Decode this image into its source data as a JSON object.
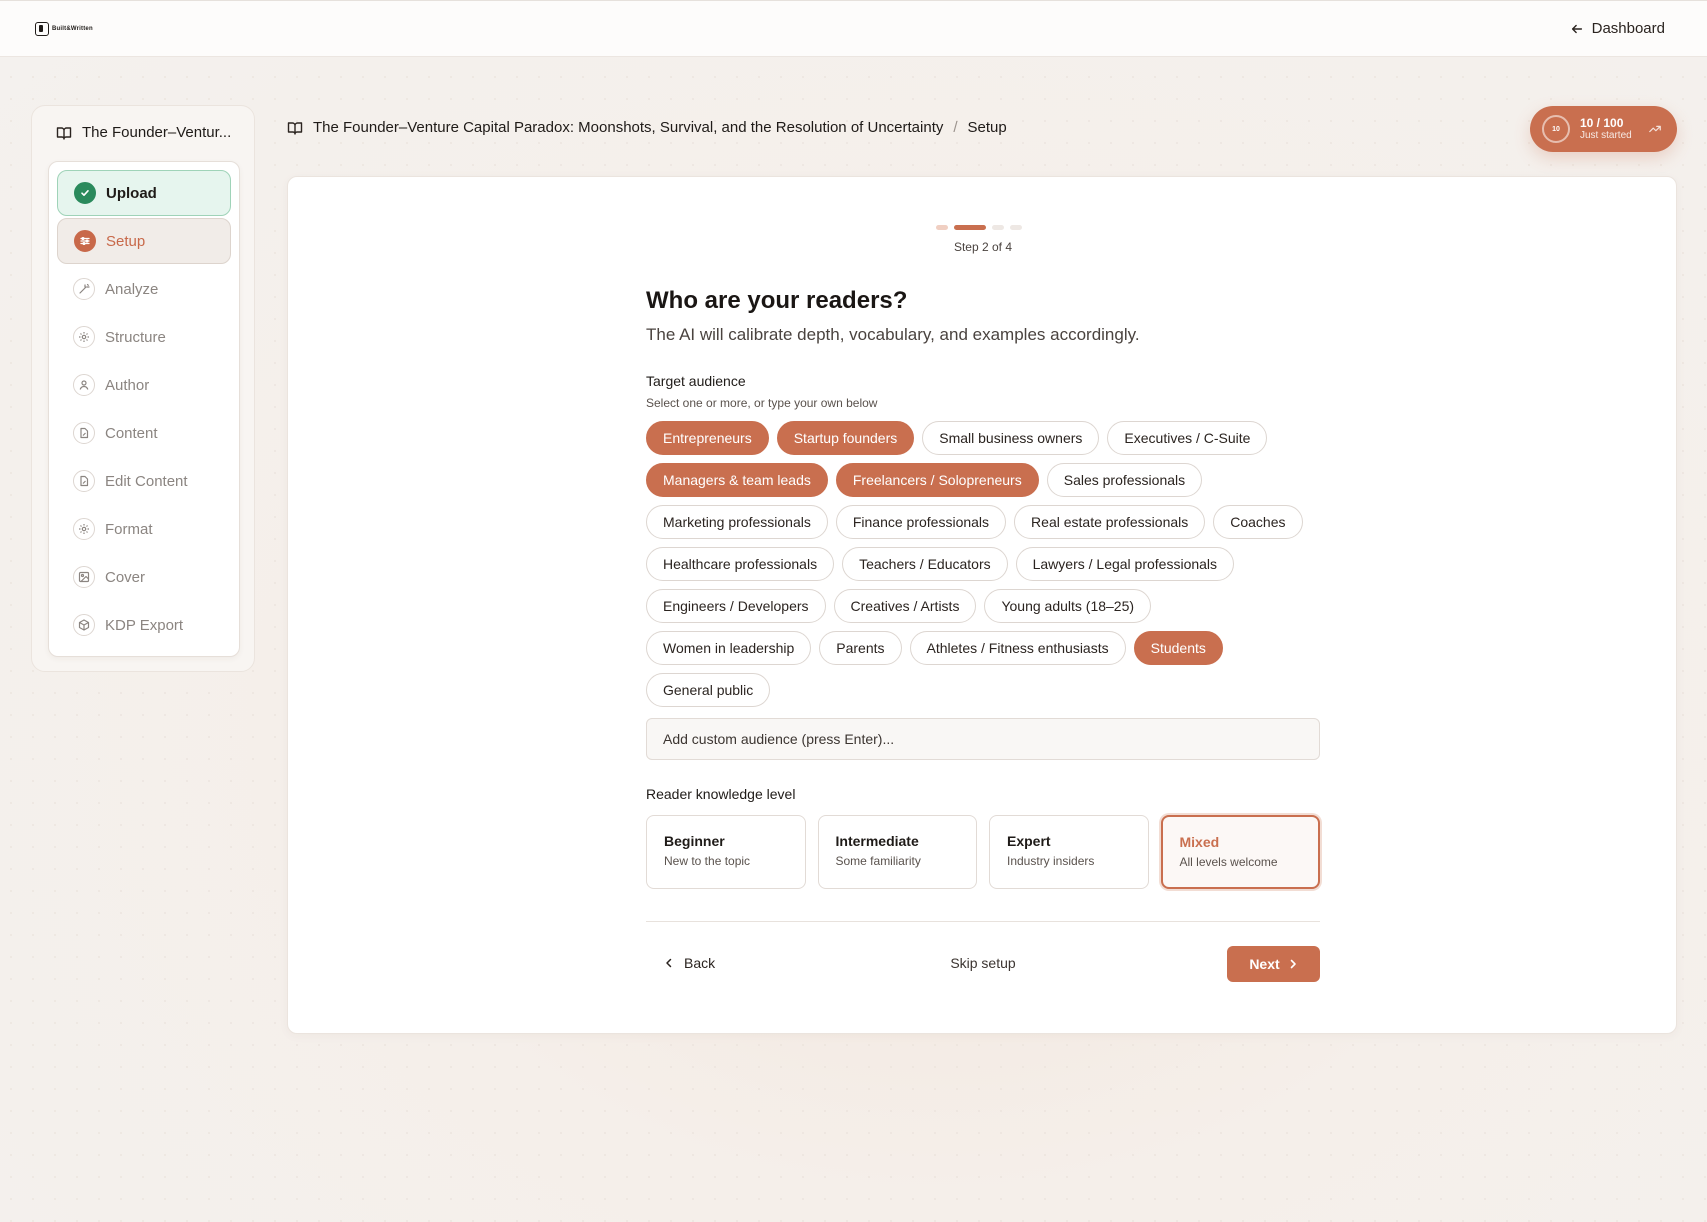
{
  "app": {
    "logo_text": "Built&Written",
    "dashboard_link": "Dashboard"
  },
  "sidebar": {
    "book_title": "The Founder–Ventur...",
    "items": [
      {
        "label": "Upload",
        "icon": "check-circle-icon",
        "state": "done"
      },
      {
        "label": "Setup",
        "icon": "sliders-icon",
        "state": "active"
      },
      {
        "label": "Analyze",
        "icon": "wand-icon",
        "state": "pending"
      },
      {
        "label": "Structure",
        "icon": "gear-icon",
        "state": "pending"
      },
      {
        "label": "Author",
        "icon": "user-icon",
        "state": "pending"
      },
      {
        "label": "Content",
        "icon": "file-edit-icon",
        "state": "pending"
      },
      {
        "label": "Edit Content",
        "icon": "file-edit-icon",
        "state": "pending"
      },
      {
        "label": "Format",
        "icon": "gear-icon",
        "state": "pending"
      },
      {
        "label": "Cover",
        "icon": "image-icon",
        "state": "pending"
      },
      {
        "label": "KDP Export",
        "icon": "package-icon",
        "state": "pending"
      }
    ]
  },
  "breadcrumb": {
    "book": "The Founder–Venture Capital Paradox: Moonshots, Survival, and the Resolution of Uncertainty",
    "separator": "/",
    "page": "Setup"
  },
  "score": {
    "ring_value": "10",
    "value_text": "10 / 100",
    "status": "Just started"
  },
  "wizard": {
    "step_label": "Step 2 of 4",
    "title": "Who are your readers?",
    "subtitle": "The AI will calibrate depth, vocabulary, and examples accordingly.",
    "audience_label": "Target audience",
    "audience_hint": "Select one or more, or type your own below",
    "audiences": [
      {
        "label": "Entrepreneurs",
        "selected": true
      },
      {
        "label": "Startup founders",
        "selected": true
      },
      {
        "label": "Small business owners",
        "selected": false
      },
      {
        "label": "Executives / C-Suite",
        "selected": false
      },
      {
        "label": "Managers & team leads",
        "selected": true
      },
      {
        "label": "Freelancers / Solopreneurs",
        "selected": true
      },
      {
        "label": "Sales professionals",
        "selected": false
      },
      {
        "label": "Marketing professionals",
        "selected": false
      },
      {
        "label": "Finance professionals",
        "selected": false
      },
      {
        "label": "Real estate professionals",
        "selected": false
      },
      {
        "label": "Coaches",
        "selected": false
      },
      {
        "label": "Healthcare professionals",
        "selected": false
      },
      {
        "label": "Teachers / Educators",
        "selected": false
      },
      {
        "label": "Lawyers / Legal professionals",
        "selected": false
      },
      {
        "label": "Engineers / Developers",
        "selected": false
      },
      {
        "label": "Creatives / Artists",
        "selected": false
      },
      {
        "label": "Young adults (18–25)",
        "selected": false
      },
      {
        "label": "Women in leadership",
        "selected": false
      },
      {
        "label": "Parents",
        "selected": false
      },
      {
        "label": "Athletes / Fitness enthusiasts",
        "selected": false
      },
      {
        "label": "Students",
        "selected": true
      },
      {
        "label": "General public",
        "selected": false
      }
    ],
    "custom_placeholder": "Add custom audience (press Enter)...",
    "knowledge_label": "Reader knowledge level",
    "levels": [
      {
        "title": "Beginner",
        "desc": "New to the topic",
        "selected": false
      },
      {
        "title": "Intermediate",
        "desc": "Some familiarity",
        "selected": false
      },
      {
        "title": "Expert",
        "desc": "Industry insiders",
        "selected": false
      },
      {
        "title": "Mixed",
        "desc": "All levels welcome",
        "selected": true
      }
    ],
    "back_label": "Back",
    "skip_label": "Skip setup",
    "next_label": "Next"
  },
  "colors": {
    "accent": "#c96f4f",
    "success": "#2a8a5c",
    "success_bg": "#e6f5ee"
  }
}
